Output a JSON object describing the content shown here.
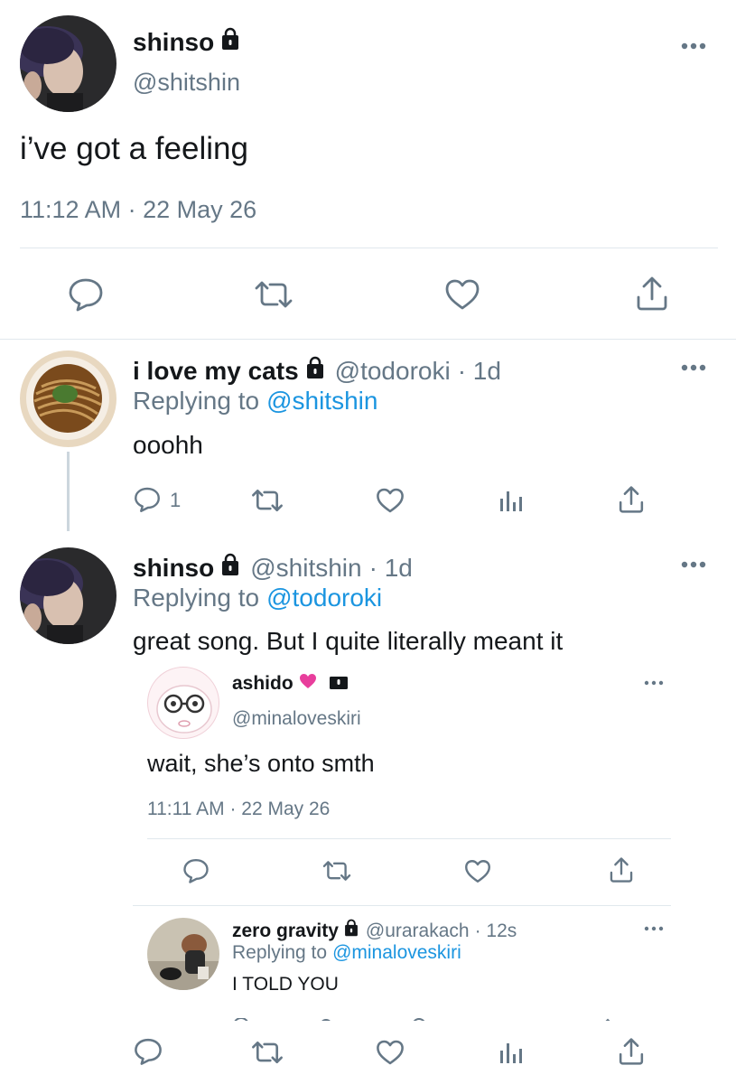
{
  "main_tweet": {
    "display_name": "shinso",
    "handle": "@shitshin",
    "text": "i’ve got a feeling",
    "timestamp": "11:12 AM · 22 May 26"
  },
  "reply_1": {
    "display_name": "i love my cats",
    "handle": "@todoroki",
    "age": "· 1d",
    "replying_prefix": "Replying to",
    "replying_to": "@shitshin",
    "text": "ooohh",
    "reply_count": "1"
  },
  "reply_2": {
    "display_name": "shinso",
    "handle": "@shitshin",
    "age": "· 1d",
    "replying_prefix": "Replying to",
    "replying_to": "@todoroki",
    "text": "great song. But I quite literally meant it"
  },
  "quoted_tweet": {
    "display_name": "ashido",
    "handle": "@minaloveskiri",
    "text": "wait, she’s onto smth",
    "timestamp": "11:11 AM · 22 May 26"
  },
  "nested_reply": {
    "display_name": "zero gravity",
    "handle": "@urarakach",
    "age": "· 12s",
    "replying_prefix": "Replying to",
    "replying_to": "@minaloveskiri",
    "text": "I TOLD YOU"
  },
  "colors": {
    "link_blue": "#1b95e0",
    "text_dark": "#14171a",
    "text_gray": "#657786",
    "divider": "#e1e8ed",
    "emoji_pink": "#e83e9c"
  },
  "icons": [
    "reply-icon",
    "retweet-icon",
    "like-icon",
    "share-icon",
    "analytics-icon",
    "lock-icon",
    "more-icon",
    "pink-heart-icon"
  ]
}
